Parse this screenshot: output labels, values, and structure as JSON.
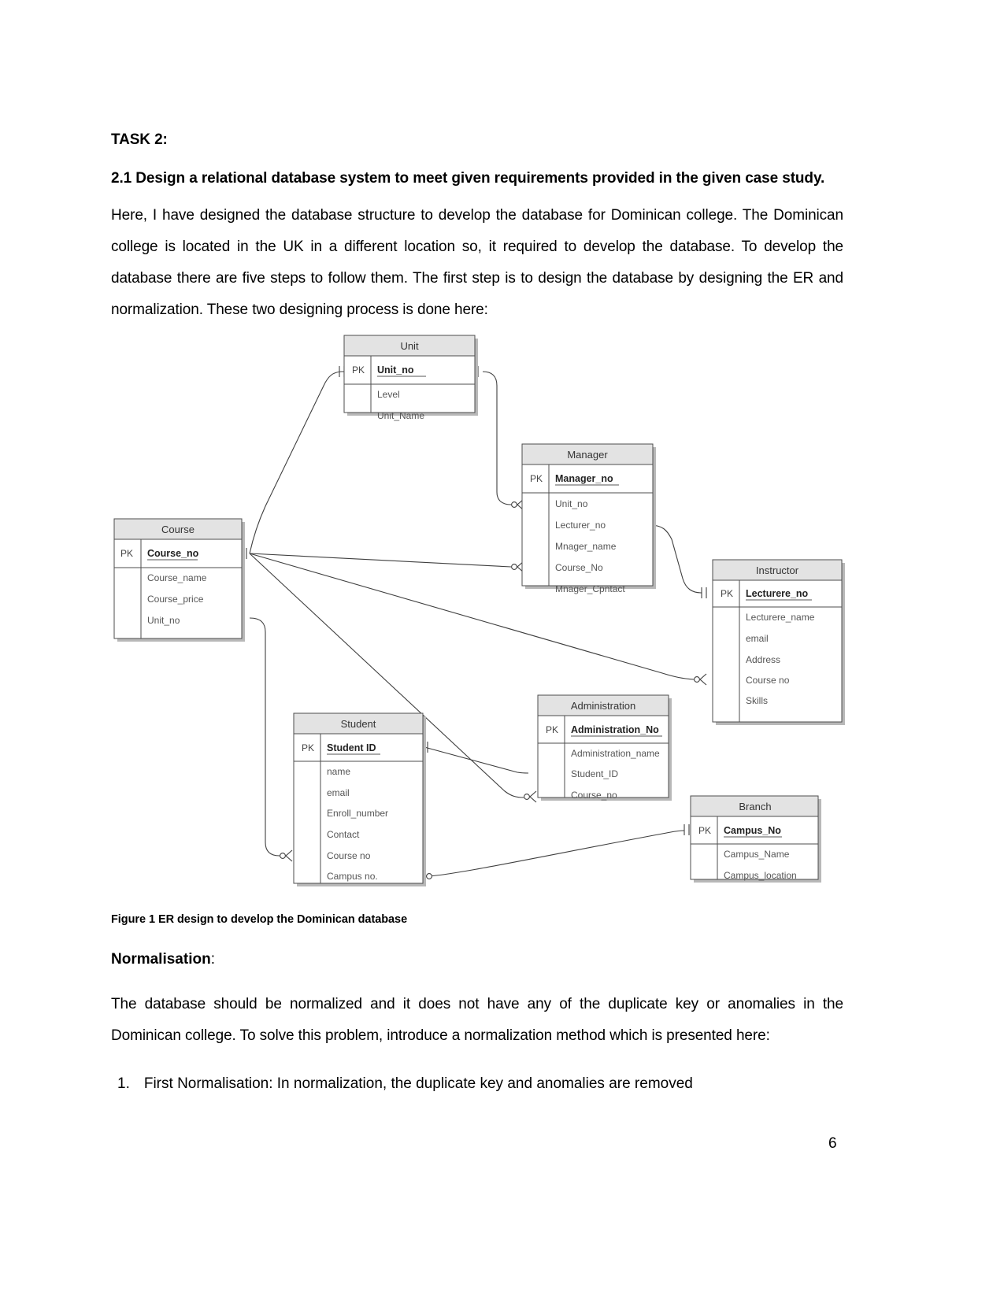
{
  "document": {
    "task_heading": "TASK 2:",
    "section_heading": "2.1 Design a relational database system to meet given requirements provided in the given case study.",
    "intro_paragraph": "Here, I have designed the database structure to develop the database for Dominican college.    The Dominican college is located in the UK in a different location so, it required to develop the database. To develop the database there are five steps to follow them. The first step is to design the database by designing the ER and normalization. These two designing process is done here:",
    "figure_caption": "Figure 1 ER design to develop the Dominican database",
    "normalisation_heading": "Normalisation",
    "normalisation_heading_colon": ":",
    "normalisation_paragraph": "The database should be normalized and it does not have any of the duplicate key or anomalies in the Dominican college. To solve this problem, introduce a normalization method which is presented here:",
    "list": [
      {
        "number": "1.",
        "text": "First Normalisation: In normalization, the duplicate key and anomalies are removed"
      }
    ],
    "page_number": "6"
  },
  "er_diagram": {
    "pk_label": "PK",
    "entities": [
      {
        "id": "unit",
        "title": "Unit",
        "pk": "Unit_no",
        "attributes": [
          "Level",
          "Unit_Name"
        ]
      },
      {
        "id": "manager",
        "title": "Manager",
        "pk": "Manager_no",
        "attributes": [
          "Unit_no",
          "Lecturer_no",
          "Mnager_name",
          "Course_No",
          "Mnager_Cpntact"
        ]
      },
      {
        "id": "course",
        "title": "Course",
        "pk": "Course_no",
        "attributes": [
          "Course_name",
          "Course_price",
          "Unit_no"
        ]
      },
      {
        "id": "instructor",
        "title": "Instructor",
        "pk": "Lecturere_no",
        "attributes": [
          "Lecturere_name",
          "email",
          "Address",
          "Course no",
          "Skills"
        ]
      },
      {
        "id": "student",
        "title": "Student",
        "pk": "Student ID",
        "attributes": [
          "name",
          "email",
          "Enroll_number",
          "Contact",
          "Course no",
          "Campus no."
        ]
      },
      {
        "id": "administration",
        "title": "Administration",
        "pk": "Administration_No",
        "attributes": [
          "Administration_name",
          "Student_ID",
          "Course_no"
        ]
      },
      {
        "id": "branch",
        "title": "Branch",
        "pk": "Campus_No",
        "attributes": [
          "Campus_Name",
          "Campus_location"
        ]
      }
    ],
    "colors": {
      "header_fill": "#e3e3e3",
      "body_fill": "#ffffff",
      "border": "#4d4d4d",
      "connector": "#3f3f3f"
    }
  }
}
